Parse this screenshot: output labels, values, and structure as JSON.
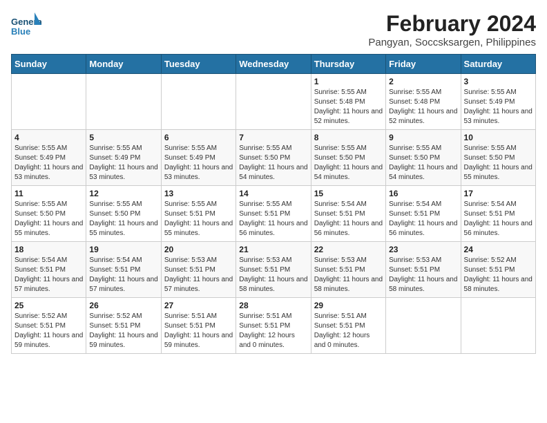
{
  "header": {
    "logo_general": "General",
    "logo_blue": "Blue",
    "month_title": "February 2024",
    "location": "Pangyan, Soccsksargen, Philippines"
  },
  "days_of_week": [
    "Sunday",
    "Monday",
    "Tuesday",
    "Wednesday",
    "Thursday",
    "Friday",
    "Saturday"
  ],
  "weeks": [
    [
      {
        "day": "",
        "info": ""
      },
      {
        "day": "",
        "info": ""
      },
      {
        "day": "",
        "info": ""
      },
      {
        "day": "",
        "info": ""
      },
      {
        "day": "1",
        "info": "Sunrise: 5:55 AM\nSunset: 5:48 PM\nDaylight: 11 hours and 52 minutes."
      },
      {
        "day": "2",
        "info": "Sunrise: 5:55 AM\nSunset: 5:48 PM\nDaylight: 11 hours and 52 minutes."
      },
      {
        "day": "3",
        "info": "Sunrise: 5:55 AM\nSunset: 5:49 PM\nDaylight: 11 hours and 53 minutes."
      }
    ],
    [
      {
        "day": "4",
        "info": "Sunrise: 5:55 AM\nSunset: 5:49 PM\nDaylight: 11 hours and 53 minutes."
      },
      {
        "day": "5",
        "info": "Sunrise: 5:55 AM\nSunset: 5:49 PM\nDaylight: 11 hours and 53 minutes."
      },
      {
        "day": "6",
        "info": "Sunrise: 5:55 AM\nSunset: 5:49 PM\nDaylight: 11 hours and 53 minutes."
      },
      {
        "day": "7",
        "info": "Sunrise: 5:55 AM\nSunset: 5:50 PM\nDaylight: 11 hours and 54 minutes."
      },
      {
        "day": "8",
        "info": "Sunrise: 5:55 AM\nSunset: 5:50 PM\nDaylight: 11 hours and 54 minutes."
      },
      {
        "day": "9",
        "info": "Sunrise: 5:55 AM\nSunset: 5:50 PM\nDaylight: 11 hours and 54 minutes."
      },
      {
        "day": "10",
        "info": "Sunrise: 5:55 AM\nSunset: 5:50 PM\nDaylight: 11 hours and 55 minutes."
      }
    ],
    [
      {
        "day": "11",
        "info": "Sunrise: 5:55 AM\nSunset: 5:50 PM\nDaylight: 11 hours and 55 minutes."
      },
      {
        "day": "12",
        "info": "Sunrise: 5:55 AM\nSunset: 5:50 PM\nDaylight: 11 hours and 55 minutes."
      },
      {
        "day": "13",
        "info": "Sunrise: 5:55 AM\nSunset: 5:51 PM\nDaylight: 11 hours and 55 minutes."
      },
      {
        "day": "14",
        "info": "Sunrise: 5:55 AM\nSunset: 5:51 PM\nDaylight: 11 hours and 56 minutes."
      },
      {
        "day": "15",
        "info": "Sunrise: 5:54 AM\nSunset: 5:51 PM\nDaylight: 11 hours and 56 minutes."
      },
      {
        "day": "16",
        "info": "Sunrise: 5:54 AM\nSunset: 5:51 PM\nDaylight: 11 hours and 56 minutes."
      },
      {
        "day": "17",
        "info": "Sunrise: 5:54 AM\nSunset: 5:51 PM\nDaylight: 11 hours and 56 minutes."
      }
    ],
    [
      {
        "day": "18",
        "info": "Sunrise: 5:54 AM\nSunset: 5:51 PM\nDaylight: 11 hours and 57 minutes."
      },
      {
        "day": "19",
        "info": "Sunrise: 5:54 AM\nSunset: 5:51 PM\nDaylight: 11 hours and 57 minutes."
      },
      {
        "day": "20",
        "info": "Sunrise: 5:53 AM\nSunset: 5:51 PM\nDaylight: 11 hours and 57 minutes."
      },
      {
        "day": "21",
        "info": "Sunrise: 5:53 AM\nSunset: 5:51 PM\nDaylight: 11 hours and 58 minutes."
      },
      {
        "day": "22",
        "info": "Sunrise: 5:53 AM\nSunset: 5:51 PM\nDaylight: 11 hours and 58 minutes."
      },
      {
        "day": "23",
        "info": "Sunrise: 5:53 AM\nSunset: 5:51 PM\nDaylight: 11 hours and 58 minutes."
      },
      {
        "day": "24",
        "info": "Sunrise: 5:52 AM\nSunset: 5:51 PM\nDaylight: 11 hours and 58 minutes."
      }
    ],
    [
      {
        "day": "25",
        "info": "Sunrise: 5:52 AM\nSunset: 5:51 PM\nDaylight: 11 hours and 59 minutes."
      },
      {
        "day": "26",
        "info": "Sunrise: 5:52 AM\nSunset: 5:51 PM\nDaylight: 11 hours and 59 minutes."
      },
      {
        "day": "27",
        "info": "Sunrise: 5:51 AM\nSunset: 5:51 PM\nDaylight: 11 hours and 59 minutes."
      },
      {
        "day": "28",
        "info": "Sunrise: 5:51 AM\nSunset: 5:51 PM\nDaylight: 12 hours and 0 minutes."
      },
      {
        "day": "29",
        "info": "Sunrise: 5:51 AM\nSunset: 5:51 PM\nDaylight: 12 hours and 0 minutes."
      },
      {
        "day": "",
        "info": ""
      },
      {
        "day": "",
        "info": ""
      }
    ]
  ]
}
